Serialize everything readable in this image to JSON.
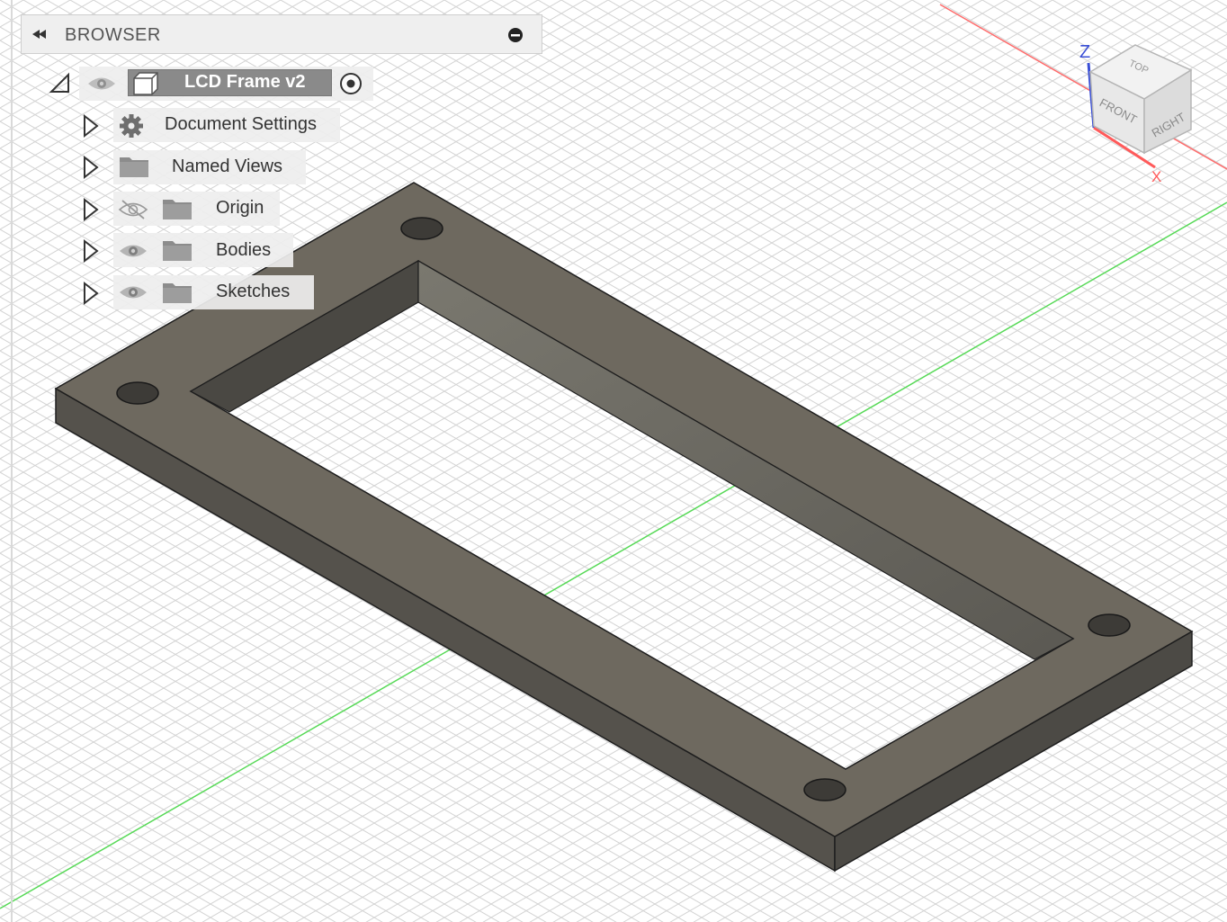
{
  "browser": {
    "title": "BROWSER",
    "root": {
      "label": "LCD Frame v2"
    },
    "items": [
      {
        "label": "Document Settings",
        "icon": "gear-icon",
        "eye": "none"
      },
      {
        "label": "Named Views",
        "icon": "folder-icon",
        "eye": "none"
      },
      {
        "label": "Origin",
        "icon": "folder-icon",
        "eye": "hidden"
      },
      {
        "label": "Bodies",
        "icon": "folder-icon",
        "eye": "visible"
      },
      {
        "label": "Sketches",
        "icon": "folder-icon",
        "eye": "visible"
      }
    ]
  },
  "viewcube": {
    "faces": {
      "top": "TOP",
      "front": "FRONT",
      "right": "RIGHT"
    },
    "axes": {
      "z": "Z",
      "x": "X"
    }
  },
  "colors": {
    "grid": "#d6d6d6",
    "axis_x": "#ff5a5a",
    "axis_y": "#55dd55",
    "axis_z": "#3a4fd6",
    "body_top": "#6f6a60",
    "body_side": "#55524c"
  }
}
